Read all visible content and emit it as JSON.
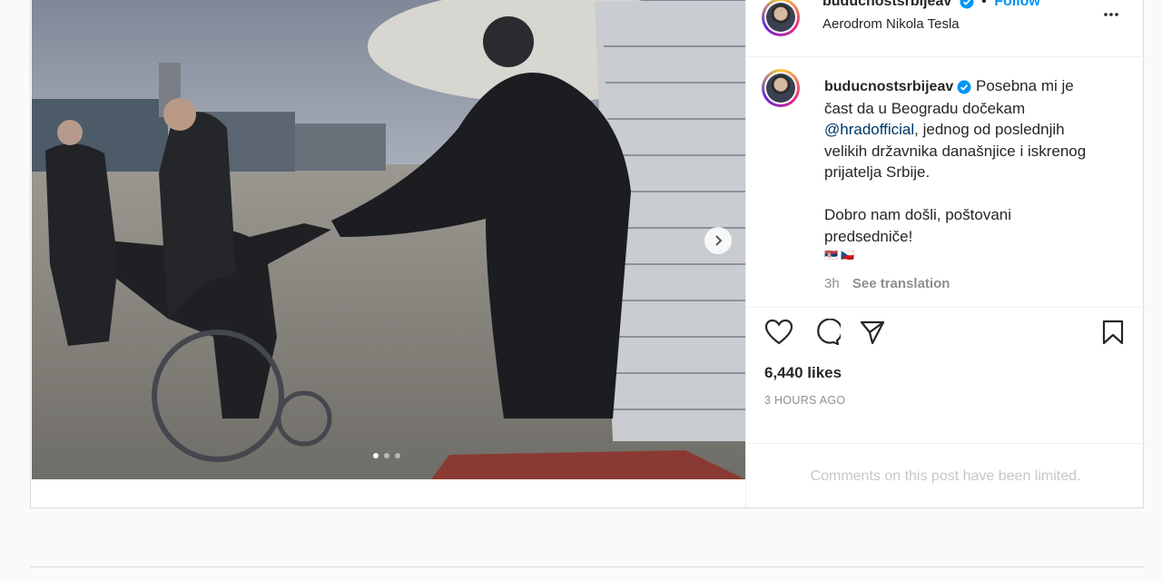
{
  "post": {
    "username": "buducnostsrbijeav",
    "follow_label": "Follow",
    "location": "Aerodrom Nikola Tesla",
    "caption_lines": [
      "Posebna mi je",
      "čast da u Beogradu dočekam",
      "@hradofficial",
      ", jednog od poslednjih",
      "velikih državnika današnjice i iskrenog",
      "prijatelja Srbije.",
      "Dobro nam došli, poštovani",
      "predsedniče!",
      "🇷🇸 🇨🇿"
    ],
    "caption_age": "3h",
    "see_translation": "See translation",
    "likes": "6,440 likes",
    "timestamp": "3 HOURS AGO",
    "comments_limited": "Comments on this post have been limited.",
    "carousel": {
      "slide_count": 3,
      "active_slide": 1
    }
  },
  "icons": {
    "more": "more-options-icon",
    "like": "heart-icon",
    "comment": "comment-icon",
    "share": "share-icon",
    "save": "bookmark-icon",
    "next": "chevron-right-icon",
    "verified": "verified-badge-icon"
  },
  "colors": {
    "accent": "#0095f6",
    "verified": "#0095f6",
    "muted": "#8e8e8e",
    "mention": "#00376b"
  }
}
